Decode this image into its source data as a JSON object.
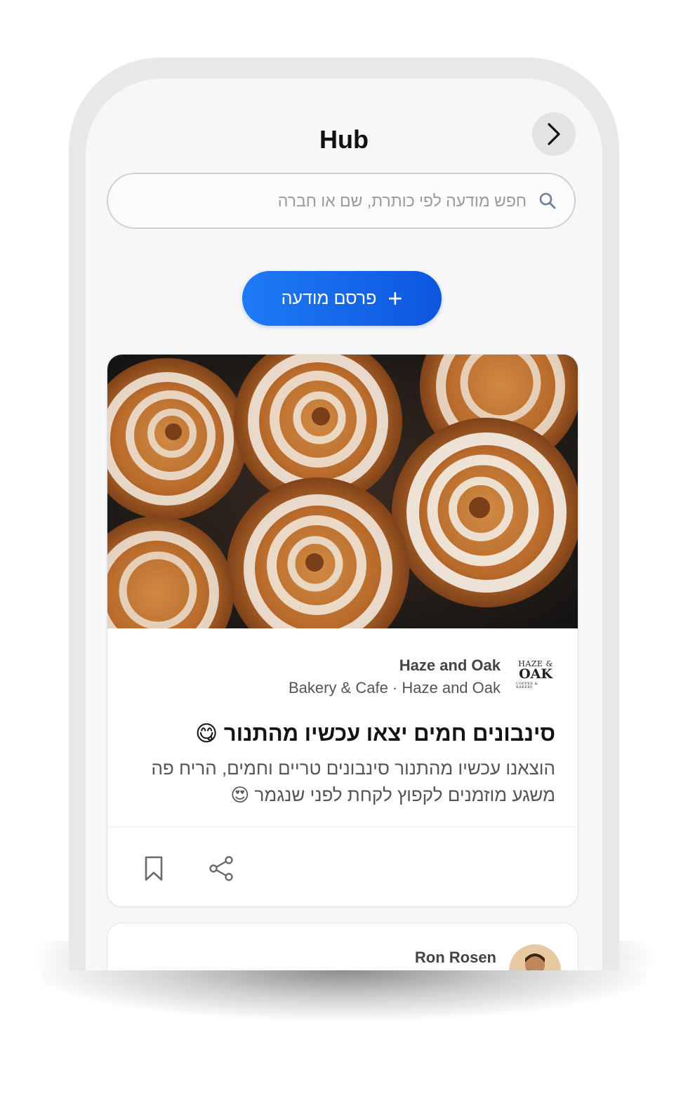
{
  "header": {
    "title": "Hub",
    "nav_icon": "chevron-right-icon"
  },
  "search": {
    "placeholder": "חפש מודעה לפי כותרת, שם או חברה",
    "icon": "search-icon"
  },
  "publish_button": {
    "label": "פרסם מודעה",
    "icon": "plus-icon",
    "color": "#1466ea"
  },
  "feed": {
    "post1": {
      "business_name": "Haze and Oak",
      "business_subtitle": "Bakery & Cafe · Haze and Oak",
      "logo": {
        "line1": "HAZE &",
        "line2": "OAK",
        "line3": "COFFEE & BAKERY"
      },
      "title": "סינבונים חמים יצאו עכשיו מהתנור 😋",
      "body": "הוצאנו עכשיו מהתנור סינבונים טריים וחמים, הריח פה משגע מוזמנים לקפוץ לקחת לפני שנגמר 😍",
      "actions": [
        "bookmark-icon",
        "share-icon"
      ]
    },
    "post2": {
      "author_name": "Ron Rosen"
    }
  },
  "colors": {
    "accent": "#1466ea",
    "screen_bg": "#f7f7f7",
    "frame": "#e8e8e8"
  }
}
